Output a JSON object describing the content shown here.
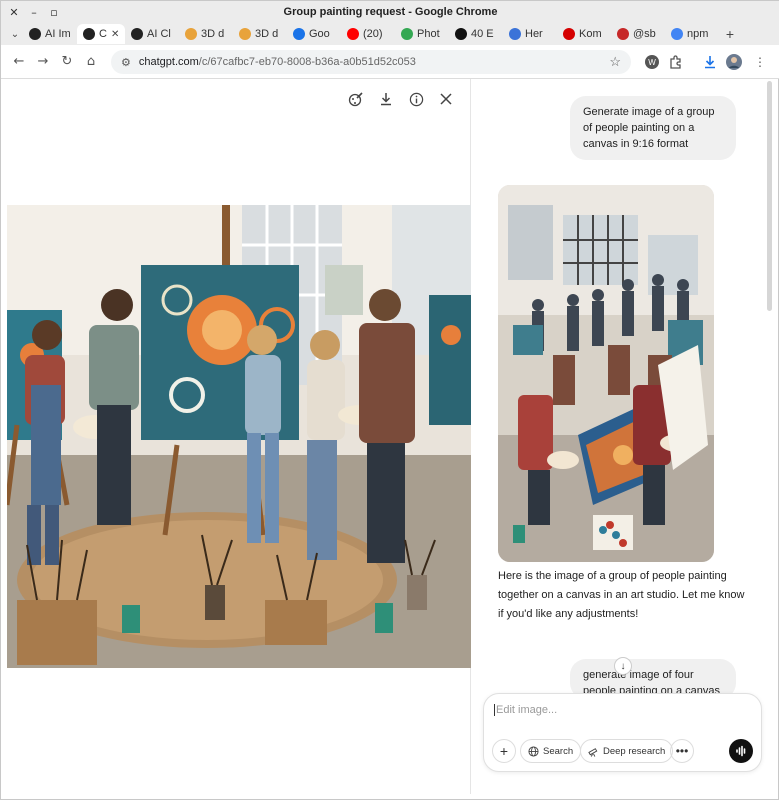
{
  "window": {
    "title": "Group painting request - Google Chrome"
  },
  "tabs": [
    {
      "label": "AI Im",
      "icon": "openai-icon",
      "color": "#222222"
    },
    {
      "label": "C",
      "icon": "openai-icon",
      "color": "#222222",
      "active": true
    },
    {
      "label": "AI Cl",
      "icon": "openai-icon",
      "color": "#222222"
    },
    {
      "label": "3D d",
      "icon": "grid-icon",
      "color": "#e8a33b"
    },
    {
      "label": "3D d",
      "icon": "grid-icon",
      "color": "#e8a33b"
    },
    {
      "label": "Goo",
      "icon": "calendar-icon",
      "color": "#1a73e8"
    },
    {
      "label": "(20)",
      "icon": "youtube-icon",
      "color": "#ff0000"
    },
    {
      "label": "Phot",
      "icon": "pinwheel-icon",
      "color": "#34a853"
    },
    {
      "label": "40 E",
      "icon": "book-icon",
      "color": "#111111"
    },
    {
      "label": "Her",
      "icon": "app-icon",
      "color": "#3b73d8"
    },
    {
      "label": "Kom",
      "icon": "opera-icon",
      "color": "#d50000"
    },
    {
      "label": "@sb",
      "icon": "square-icon",
      "color": "#c62828"
    },
    {
      "label": "npm",
      "icon": "google-icon",
      "color": "#4285f4"
    }
  ],
  "address": {
    "host": "chatgpt.com",
    "path": "/c/67cafbc7-eb70-8008-b36a-a0b51d52c053"
  },
  "chat": {
    "user_message_1": "Generate image of a group of people painting on a canvas in 9:16 format",
    "assistant_reply": "Here is the image of a group of people painting together on a canvas in an art studio. Let me know if you'd like any adjustments!",
    "user_message_2": "generate image of four people painting on a canvas"
  },
  "composer": {
    "placeholder": "Edit image...",
    "search_label": "Search",
    "deep_research_label": "Deep research"
  },
  "colors": {
    "accent": "#111111",
    "bubble": "#f0f0f0"
  }
}
